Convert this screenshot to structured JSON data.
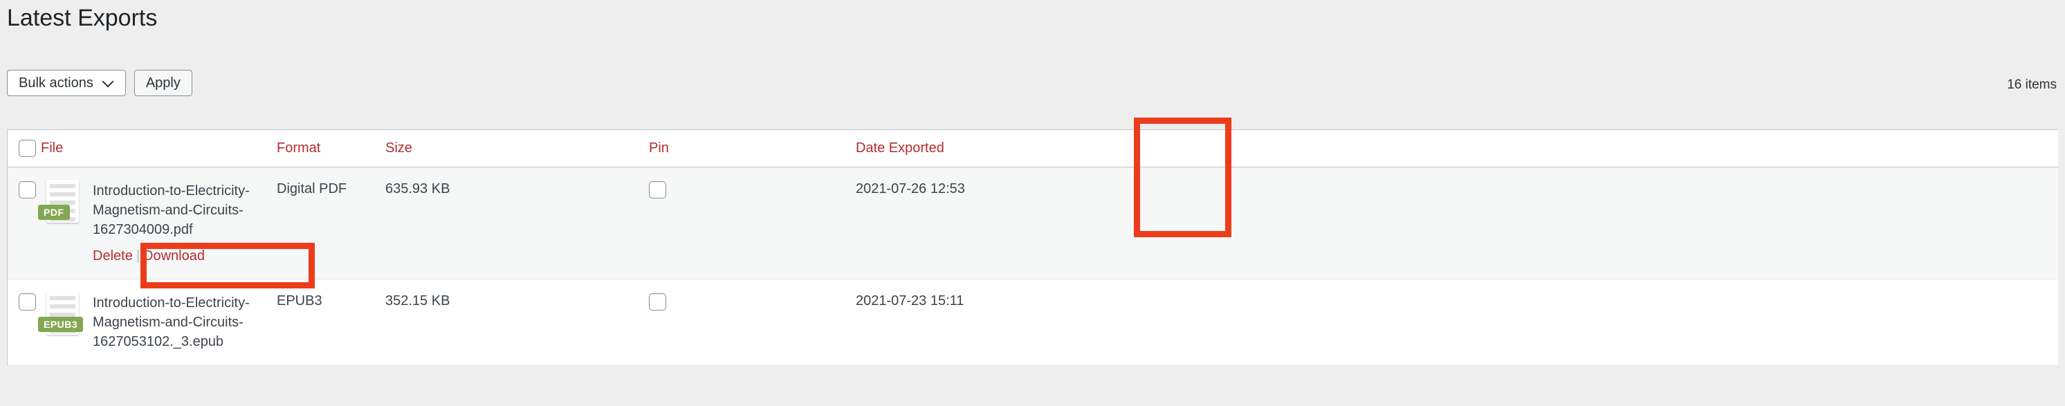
{
  "header": {
    "title": "Latest Exports"
  },
  "toolbar": {
    "bulk_actions_label": "Bulk actions",
    "apply_label": "Apply",
    "chevron_icon": "chevron-down-icon"
  },
  "pagination": {
    "items_count": "16 items"
  },
  "table": {
    "columns": [
      {
        "key": "check",
        "label": ""
      },
      {
        "key": "file",
        "label": "File"
      },
      {
        "key": "format",
        "label": "Format"
      },
      {
        "key": "size",
        "label": "Size"
      },
      {
        "key": "pin",
        "label": "Pin"
      },
      {
        "key": "date",
        "label": "Date Exported"
      }
    ],
    "rows": [
      {
        "selected": false,
        "file_name": "Introduction-to-Electricity-Magnetism-and-Circuits-1627304009.pdf",
        "badge": "PDF",
        "icon": "document-file-icon",
        "actions": {
          "delete": "Delete",
          "separator": "|",
          "download": "Download"
        },
        "format": "Digital PDF",
        "size": "635.93 KB",
        "pinned": false,
        "date": "2021-07-26 12:53"
      },
      {
        "selected": false,
        "file_name": "Introduction-to-Electricity-Magnetism-and-Circuits-1627053102._3.epub",
        "badge": "EPUB3",
        "icon": "document-file-icon",
        "actions": null,
        "format": "EPUB3",
        "size": "352.15 KB",
        "pinned": false,
        "date": "2021-07-23 15:11"
      }
    ]
  },
  "annotations": {
    "highlight_color": "#ec3c1a",
    "boxes": [
      {
        "name": "row-actions-highlight",
        "target": "Delete | Download"
      },
      {
        "name": "pin-column-highlight",
        "target": "Pin"
      }
    ]
  },
  "colors": {
    "accent_link": "#b32d2e",
    "badge_green": "#82a853",
    "page_background": "#eeeeee",
    "row_alt_background": "#f6f7f7"
  }
}
